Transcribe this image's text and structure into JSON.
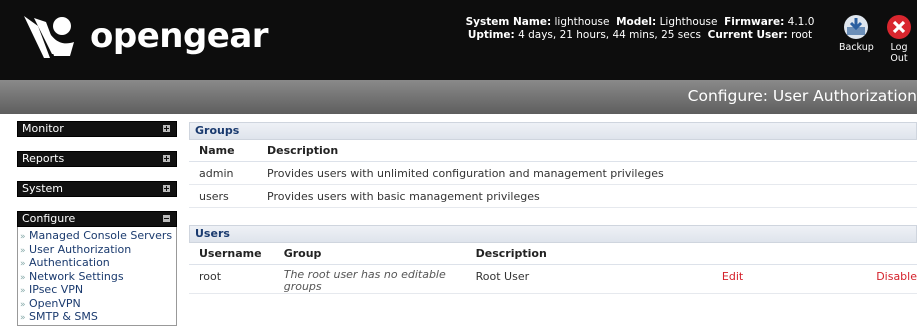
{
  "header": {
    "logo_text": "opengear",
    "system_name_label": "System Name:",
    "system_name": "lighthouse",
    "model_label": "Model:",
    "model": "Lighthouse",
    "firmware_label": "Firmware:",
    "firmware": "4.1.0",
    "uptime_label": "Uptime:",
    "uptime": "4 days, 21 hours, 44 mins, 25 secs",
    "current_user_label": "Current User:",
    "current_user": "root",
    "backup_label": "Backup",
    "logout_label": "Log Out"
  },
  "page_title": "Configure: User Authorization",
  "sidebar": {
    "menus": [
      {
        "label": "Monitor"
      },
      {
        "label": "Reports"
      },
      {
        "label": "System"
      },
      {
        "label": "Configure"
      }
    ],
    "configure_items": [
      "Managed Console Servers",
      "User Authorization",
      "Authentication",
      "Network Settings",
      "IPsec VPN",
      "OpenVPN",
      "SMTP & SMS"
    ],
    "item_prefix": "»"
  },
  "groups": {
    "title": "Groups",
    "columns": [
      "Name",
      "Description"
    ],
    "rows": [
      {
        "name": "admin",
        "description": "Provides users with unlimited configuration and management privileges"
      },
      {
        "name": "users",
        "description": "Provides users with basic management privileges"
      }
    ]
  },
  "users": {
    "title": "Users",
    "columns": [
      "Username",
      "Group",
      "Description"
    ],
    "rows": [
      {
        "username": "root",
        "group_line1": "The root user has no editable",
        "group_line2": "groups",
        "description": "Root User",
        "edit": "Edit",
        "disable": "Disable"
      }
    ]
  },
  "colors": {
    "header_bg": "#0d0d0d",
    "accent_link": "#d4202a",
    "section_title": "#1a3a6e"
  }
}
